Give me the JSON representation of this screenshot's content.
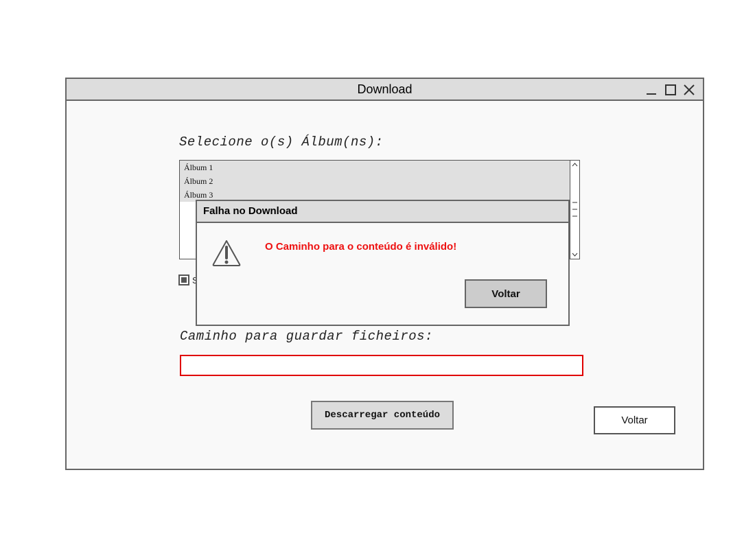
{
  "window": {
    "title": "Download",
    "controls": [
      "minimize-icon",
      "maximize-icon",
      "close-icon"
    ]
  },
  "albums": {
    "label": "Selecione o(s) Álbum(ns):",
    "items": [
      "Álbum 1",
      "Álbum 2",
      "Álbum 3"
    ]
  },
  "checkbox": {
    "label": "S",
    "checked": true
  },
  "path": {
    "label": "Caminho para guardar ficheiros:",
    "value": "",
    "placeholder": "",
    "error_color": "#e00000"
  },
  "actions": {
    "download_label": "Descarregar conteúdo",
    "back_label": "Voltar"
  },
  "dialog": {
    "title": "Falha no Download",
    "message": "O Caminho para o conteúdo é inválido!",
    "message_color": "#ee1111",
    "button_label": "Voltar",
    "icon": "warning-icon"
  }
}
